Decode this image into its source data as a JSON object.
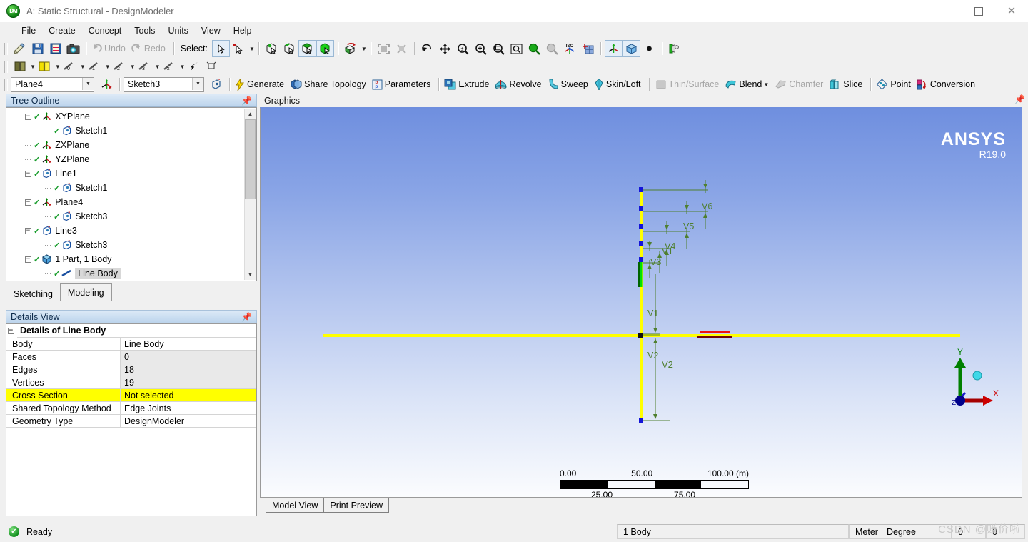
{
  "window": {
    "title": "A: Static Structural - DesignModeler",
    "app_icon": "designmodeler-icon",
    "minimize": "—",
    "maximize": "□",
    "close": "✕"
  },
  "menu": {
    "items": [
      "File",
      "Create",
      "Concept",
      "Tools",
      "Units",
      "View",
      "Help"
    ]
  },
  "toolbar_main": {
    "icons": [
      "new-sketch-icon",
      "save-icon",
      "save-as-icon",
      "screenshot-icon"
    ],
    "undo_label": "Undo",
    "redo_label": "Redo",
    "select_label": "Select:",
    "select_modes": [
      "single-select-icon",
      "box-select-icon"
    ],
    "filter_icons": [
      "select-vertices-icon",
      "select-edges-icon",
      "select-faces-icon",
      "select-bodies-icon"
    ],
    "extend_icon": "extend-selection-icon",
    "view_icons": [
      "toggle-frame-icon",
      "hide-face-icon"
    ],
    "nav_icons": [
      "rotate-icon",
      "pan-icon",
      "zoom-icon",
      "box-zoom-icon",
      "zoom-window-icon",
      "zoom-to-fit-icon",
      "zoom-in-icon",
      "zoom-out-icon",
      "iso-view-icon",
      "look-at-icon"
    ],
    "display_icons": [
      "display-plane-icon",
      "display-model-icon",
      "display-points-icon",
      "cross-section-icon"
    ]
  },
  "toolbar_plane": {
    "icons": [
      "display-plane-1-icon",
      "display-plane-2-icon",
      "ruler-0-icon",
      "ruler-1-icon",
      "ruler-2-icon",
      "ruler-3-icon",
      "ruler-x-icon",
      "pin-plane-icon",
      "sketch-projection-icon"
    ]
  },
  "toolbar_modeling": {
    "plane_combo": "Plane4",
    "new_plane_icon": "new-plane-icon",
    "sketch_combo": "Sketch3",
    "new_sketch_icon": "new-sketch-icon",
    "generate_label": "Generate",
    "share_topology_label": "Share Topology",
    "parameters_label": "Parameters",
    "extrude_label": "Extrude",
    "revolve_label": "Revolve",
    "sweep_label": "Sweep",
    "skinloft_label": "Skin/Loft",
    "thin_surface_label": "Thin/Surface",
    "blend_label": "Blend",
    "chamfer_label": "Chamfer",
    "slice_label": "Slice",
    "point_label": "Point",
    "conversion_label": "Conversion"
  },
  "tree": {
    "title": "Tree Outline",
    "pin_icon": "pin-icon",
    "nodes": [
      {
        "label": "XYPlane",
        "indent": 1,
        "icon": "plane-icon",
        "expander": "−",
        "checked": true,
        "selected": false
      },
      {
        "label": "Sketch1",
        "indent": 2,
        "icon": "sketch-icon",
        "expander": "",
        "checked": true,
        "selected": false
      },
      {
        "label": "ZXPlane",
        "indent": 1,
        "icon": "plane-icon",
        "expander": "",
        "checked": true,
        "selected": false
      },
      {
        "label": "YZPlane",
        "indent": 1,
        "icon": "plane-icon",
        "expander": "",
        "checked": true,
        "selected": false
      },
      {
        "label": "Line1",
        "indent": 1,
        "icon": "sketch-icon",
        "expander": "−",
        "checked": true,
        "selected": false
      },
      {
        "label": "Sketch1",
        "indent": 2,
        "icon": "sketch-icon",
        "expander": "",
        "checked": true,
        "selected": false
      },
      {
        "label": "Plane4",
        "indent": 1,
        "icon": "plane-icon",
        "expander": "−",
        "checked": true,
        "selected": false
      },
      {
        "label": "Sketch3",
        "indent": 2,
        "icon": "sketch-icon",
        "expander": "",
        "checked": true,
        "selected": false
      },
      {
        "label": "Line3",
        "indent": 1,
        "icon": "sketch-icon",
        "expander": "−",
        "checked": true,
        "selected": false
      },
      {
        "label": "Sketch3",
        "indent": 2,
        "icon": "sketch-icon",
        "expander": "",
        "checked": true,
        "selected": false
      },
      {
        "label": "1 Part, 1 Body",
        "indent": 1,
        "icon": "body-icon",
        "expander": "−",
        "checked": true,
        "selected": false
      },
      {
        "label": "Line Body",
        "indent": 2,
        "icon": "line-body-icon",
        "expander": "",
        "checked": true,
        "selected": true
      }
    ]
  },
  "panel_tabs": {
    "items": [
      {
        "label": "Sketching",
        "active": false
      },
      {
        "label": "Modeling",
        "active": true
      }
    ]
  },
  "details": {
    "title": "Details View",
    "pin_icon": "pin-icon",
    "group_label": "Details of Line Body",
    "rows": [
      {
        "key": "Body",
        "value": "Line Body",
        "style": "plain"
      },
      {
        "key": "Faces",
        "value": "0",
        "style": "alt"
      },
      {
        "key": "Edges",
        "value": "18",
        "style": "alt"
      },
      {
        "key": "Vertices",
        "value": "19",
        "style": "alt"
      },
      {
        "key": "Cross Section",
        "value": "Not selected",
        "style": "highlight"
      },
      {
        "key": "Shared Topology Method",
        "value": "Edge Joints",
        "style": "plain"
      },
      {
        "key": "Geometry Type",
        "value": "DesignModeler",
        "style": "plain"
      }
    ]
  },
  "graphics": {
    "title": "Graphics",
    "pin_icon": "pin-icon",
    "logo_name": "ANSYS",
    "logo_release": "R19.0",
    "dimension_labels": [
      "V1",
      "V2",
      "V3",
      "V4",
      "V5",
      "V6"
    ],
    "scalebar": {
      "top_ticks": [
        "0.00",
        "50.00",
        "100.00 (m)"
      ],
      "bottom_ticks": [
        "25.00",
        "75.00"
      ]
    },
    "triad": {
      "x_label": "X",
      "y_label": "Y",
      "z_label": "Z",
      "x_color": "#cc0000",
      "y_color": "#008000",
      "z_color": "#00008b"
    },
    "colors": {
      "body": "#ffff00",
      "dimension": "#4f7f2f",
      "vertex": "#1414d8",
      "highlight": "#00ff00",
      "bg_top": "#6f8fdf",
      "bg_bottom": "#fbfcfe"
    },
    "tabs": [
      {
        "label": "Model View",
        "active": true
      },
      {
        "label": "Print Preview",
        "active": false
      }
    ]
  },
  "statusbar": {
    "state_icon": "ready-check-icon",
    "state": "Ready",
    "body_count": "1 Body",
    "length_unit": "Meter",
    "angle_unit": "Degree",
    "field_a": "0",
    "field_b": "0",
    "watermark": "CSDN @赚价啦"
  }
}
